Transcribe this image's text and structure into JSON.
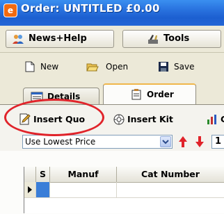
{
  "window": {
    "title": "Order: UNTITLED £0.00",
    "app_icon_letter": "e",
    "accent": "#2a74e0"
  },
  "menubar": {
    "news_help": "News+Help",
    "tools": "Tools"
  },
  "toolbar": {
    "new": "New",
    "open": "Open",
    "save": "Save"
  },
  "tabs": [
    {
      "label": "Details",
      "active": false
    },
    {
      "label": "Order",
      "active": true
    }
  ],
  "order_toolbar": {
    "insert_quote": "Insert Quo",
    "insert_kit": "Insert Kit",
    "third_visible": "C"
  },
  "price_filter": {
    "selected": "Use Lowest Price",
    "quantity": "1"
  },
  "grid": {
    "columns": [
      "S",
      "Manuf",
      "Cat Number"
    ]
  },
  "highlight_color": "#e0232a"
}
